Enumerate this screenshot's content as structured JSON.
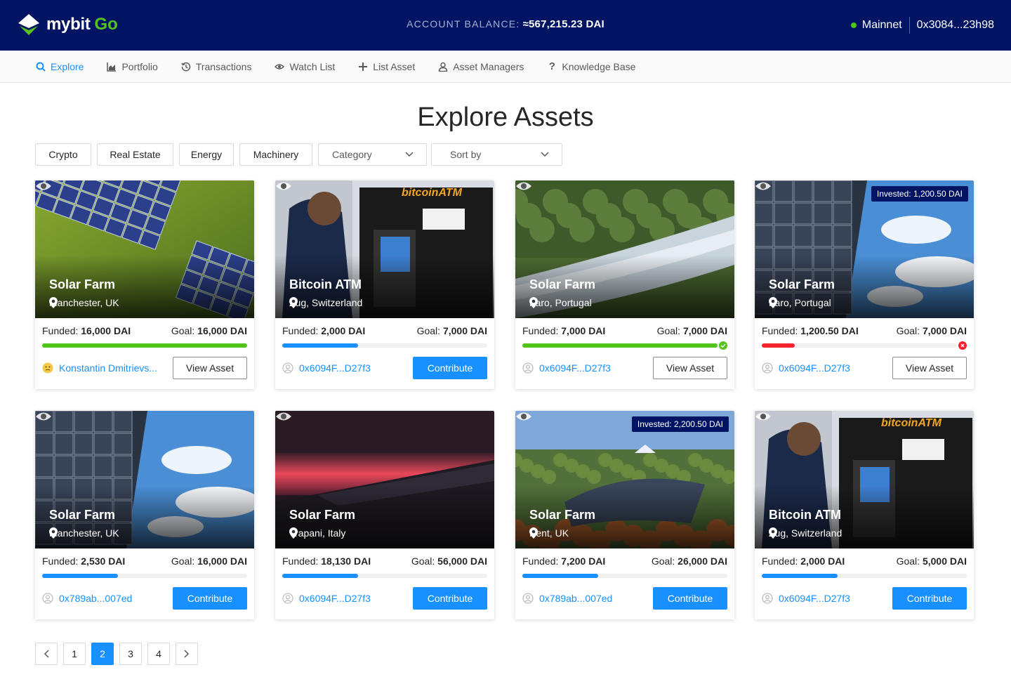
{
  "header": {
    "logo_text": "mybit",
    "logo_go": "Go",
    "balance_label": "ACCOUNT BALANCE:",
    "balance_value": "≈567,215.23 DAI",
    "network": "Mainnet",
    "address": "0x3084...23h98"
  },
  "nav": {
    "items": [
      {
        "label": "Explore",
        "icon": "search-icon"
      },
      {
        "label": "Portfolio",
        "icon": "area-chart-icon"
      },
      {
        "label": "Transactions",
        "icon": "history-icon"
      },
      {
        "label": "Watch List",
        "icon": "eye-icon"
      },
      {
        "label": "List Asset",
        "icon": "plus-icon"
      },
      {
        "label": "Asset Managers",
        "icon": "user-icon"
      },
      {
        "label": "Knowledge Base",
        "icon": "question-icon"
      }
    ]
  },
  "title": "Explore Assets",
  "filters": {
    "buttons": [
      "Crypto",
      "Real Estate",
      "Energy",
      "Machinery"
    ],
    "category_placeholder": "Category",
    "sort_placeholder": "Sort by"
  },
  "cards": [
    {
      "name": "Solar Farm",
      "location": "Manchester, UK",
      "funded_label": "Funded:",
      "funded": "16,000 DAI",
      "goal_label": "Goal:",
      "goal": "16,000 DAI",
      "progress": 1.0,
      "bar_color": "#52c41a",
      "status": "",
      "owner": "Konstantin Dmitrievs...",
      "owner_icon": "emoji-avatar-icon",
      "action": "View Asset",
      "action_style": "outline",
      "invested": "",
      "image": "solar-grass"
    },
    {
      "name": "Bitcoin ATM",
      "location": "Zug, Switzerland",
      "funded_label": "Funded:",
      "funded": "2,000 DAI",
      "goal_label": "Goal:",
      "goal": "7,000 DAI",
      "progress": 0.37,
      "bar_color": "#1890ff",
      "status": "",
      "owner": "0x6094F...D27f3",
      "owner_icon": "user-circle-icon",
      "action": "Contribute",
      "action_style": "primary",
      "invested": "",
      "image": "atm"
    },
    {
      "name": "Solar Farm",
      "location": "Faro, Portugal",
      "funded_label": "Funded:",
      "funded": "7,000 DAI",
      "goal_label": "Goal:",
      "goal": "7,000 DAI",
      "progress": 1.0,
      "bar_color": "#52c41a",
      "status": "success",
      "owner": "0x6094F...D27f3",
      "owner_icon": "user-circle-icon",
      "action": "View Asset",
      "action_style": "outline",
      "invested": "",
      "image": "roof"
    },
    {
      "name": "Solar Farm",
      "location": "Faro, Portugal",
      "funded_label": "Funded:",
      "funded": "1,200.50 DAI",
      "goal_label": "Goal:",
      "goal": "7,000 DAI",
      "progress": 0.17,
      "bar_color": "#f5222d",
      "status": "error",
      "owner": "0x6094F...D27f3",
      "owner_icon": "user-circle-icon",
      "action": "View Asset",
      "action_style": "outline",
      "invested": "Invested: 1,200.50 DAI",
      "image": "solar-sky"
    },
    {
      "name": "Solar Farm",
      "location": "Manchester, UK",
      "funded_label": "Funded:",
      "funded": "2,530 DAI",
      "goal_label": "Goal:",
      "goal": "16,000 DAI",
      "progress": 0.37,
      "bar_color": "#1890ff",
      "status": "",
      "owner": "0x789ab...007ed",
      "owner_icon": "user-circle-icon",
      "action": "Contribute",
      "action_style": "primary",
      "invested": "",
      "image": "solar-sky"
    },
    {
      "name": "Solar Farm",
      "location": "Trapani, Italy",
      "funded_label": "Funded:",
      "funded": "18,130 DAI",
      "goal_label": "Goal:",
      "goal": "56,000 DAI",
      "progress": 0.37,
      "bar_color": "#1890ff",
      "status": "",
      "owner": "0x6094F...D27f3",
      "owner_icon": "user-circle-icon",
      "action": "Contribute",
      "action_style": "primary",
      "invested": "",
      "image": "sunset"
    },
    {
      "name": "Solar Farm",
      "location": "Kent, UK",
      "funded_label": "Funded:",
      "funded": "7,200 DAI",
      "goal_label": "Goal:",
      "goal": "26,000 DAI",
      "progress": 0.37,
      "bar_color": "#1890ff",
      "status": "",
      "owner": "0x789ab...007ed",
      "owner_icon": "user-circle-icon",
      "action": "Contribute",
      "action_style": "primary",
      "invested": "Invested: 2,200.50 DAI",
      "image": "hillside"
    },
    {
      "name": "Bitcoin ATM",
      "location": "Zug, Switzerland",
      "funded_label": "Funded:",
      "funded": "2,000 DAI",
      "goal_label": "Goal:",
      "goal": "5,000 DAI",
      "progress": 0.37,
      "bar_color": "#1890ff",
      "status": "",
      "owner": "0x6094F...D27f3",
      "owner_icon": "user-circle-icon",
      "action": "Contribute",
      "action_style": "primary",
      "invested": "",
      "image": "atm"
    }
  ],
  "pagination": {
    "pages": [
      "1",
      "2",
      "3",
      "4"
    ],
    "current": "2"
  },
  "colors": {
    "header_bg": "#001463",
    "accent": "#1890ff",
    "success": "#52c41a",
    "error": "#f5222d"
  }
}
